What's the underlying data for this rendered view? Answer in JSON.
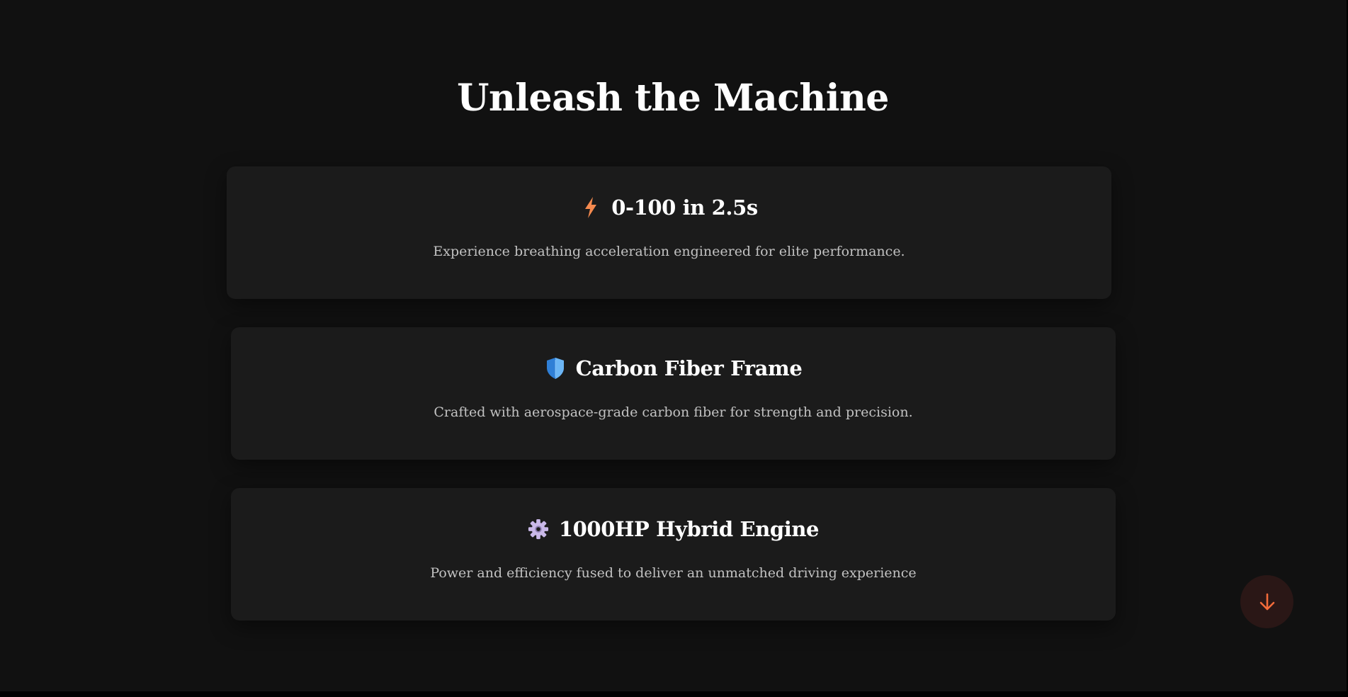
{
  "page": {
    "title": "Unleash the Machine"
  },
  "features": [
    {
      "icon": "lightning-bolt-icon",
      "title": "0-100 in 2.5s",
      "description": "Experience breathing acceleration engineered for elite performance."
    },
    {
      "icon": "shield-icon",
      "title": "Carbon Fiber Frame",
      "description": "Crafted with aerospace-grade carbon fiber for strength and precision."
    },
    {
      "icon": "gear-icon",
      "title": "1000HP Hybrid Engine",
      "description": "Power and efficiency fused to deliver an unmatched driving experience"
    }
  ],
  "scroll_button": {
    "icon": "arrow-down-icon"
  },
  "colors": {
    "background": "#111111",
    "card": "#1b1b1b",
    "accent": "#f26b3a",
    "title_text": "#ffffff",
    "body_text": "#c2c2c2"
  }
}
